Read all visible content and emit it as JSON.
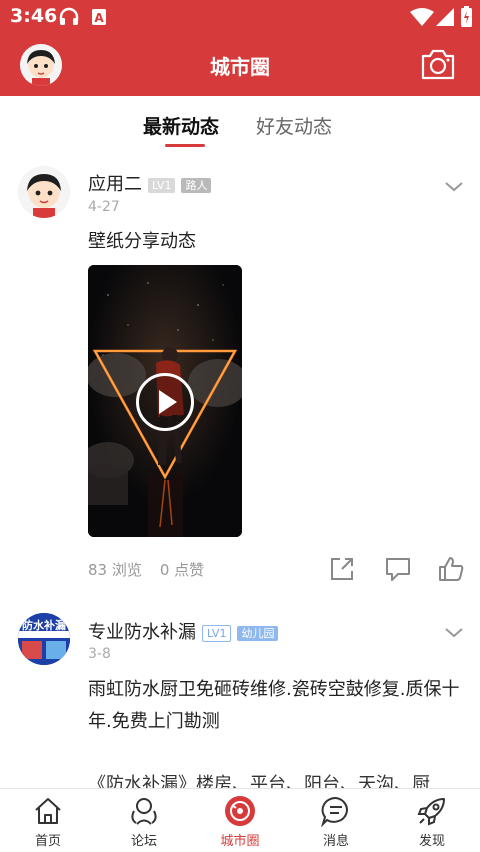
{
  "status_bar": {
    "time": "3:46",
    "icons": [
      "headphones-icon",
      "text-notification-icon",
      "wifi-icon",
      "signal-icon",
      "battery-icon"
    ]
  },
  "app_bar": {
    "title": "城市圈",
    "left": "user-avatar",
    "right": "camera-icon",
    "accent_color": "#d63a3a"
  },
  "tabs": [
    {
      "label": "最新动态",
      "active": true
    },
    {
      "label": "好友动态",
      "active": false
    }
  ],
  "posts": [
    {
      "author": "应用二",
      "level": "LV1",
      "title_badge": "路人",
      "date": "4-27",
      "text": "壁纸分享动态",
      "media": "video",
      "views": "83 浏览",
      "likes": "0 点赞",
      "actions": [
        "share-icon",
        "comment-icon",
        "like-icon"
      ]
    },
    {
      "author": "专业防水补漏",
      "level": "LV1",
      "title_badge": "幼儿园",
      "date": "3-8",
      "text": "雨虹防水厨卫免砸砖维修.瓷砖空鼓修复.质保十年.免费上门勘测",
      "cut_text": "《防水补漏》楼房、平台、阳台、天沟、厨"
    }
  ],
  "bottom_nav": [
    {
      "label": "首页",
      "icon": "home-icon",
      "active": false
    },
    {
      "label": "论坛",
      "icon": "forum-icon",
      "active": false
    },
    {
      "label": "城市圈",
      "icon": "city-circle-icon",
      "active": true
    },
    {
      "label": "消息",
      "icon": "message-icon",
      "active": false
    },
    {
      "label": "发现",
      "icon": "rocket-icon",
      "active": false
    }
  ]
}
